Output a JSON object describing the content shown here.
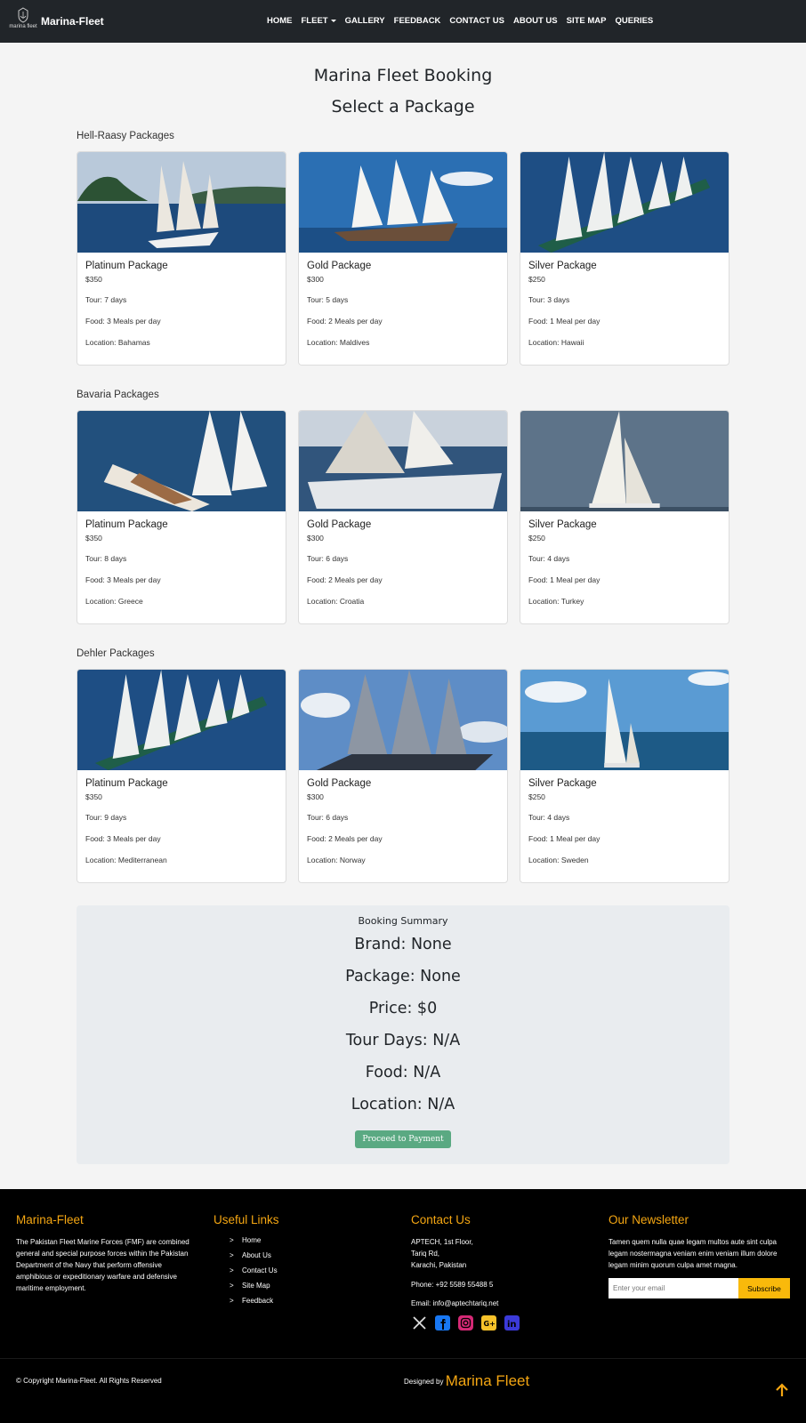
{
  "nav": {
    "logo_text": "marina fleet",
    "brand": "Marina-Fleet",
    "links": [
      "HOME",
      "FLEET",
      "GALLERY",
      "FEEDBACK",
      "CONTACT US",
      "ABOUT US",
      "SITE MAP",
      "QUERIES"
    ]
  },
  "page": {
    "title": "Marina Fleet Booking",
    "subtitle": "Select a Package"
  },
  "groups": [
    {
      "title": "Hell-Raasy Packages",
      "cards": [
        {
          "title": "Platinum Package",
          "price": "$350",
          "tour": "Tour: 7 days",
          "food": "Food: 3 Meals per day",
          "location": "Location: Bahamas"
        },
        {
          "title": "Gold Package",
          "price": "$300",
          "tour": "Tour: 5 days",
          "food": "Food: 2 Meals per day",
          "location": "Location: Maldives"
        },
        {
          "title": "Silver Package",
          "price": "$250",
          "tour": "Tour: 3 days",
          "food": "Food: 1 Meal per day",
          "location": "Location: Hawaii"
        }
      ]
    },
    {
      "title": "Bavaria Packages",
      "cards": [
        {
          "title": "Platinum Package",
          "price": "$350",
          "tour": "Tour: 8 days",
          "food": "Food: 3 Meals per day",
          "location": "Location: Greece"
        },
        {
          "title": "Gold Package",
          "price": "$300",
          "tour": "Tour: 6 days",
          "food": "Food: 2 Meals per day",
          "location": "Location: Croatia"
        },
        {
          "title": "Silver Package",
          "price": "$250",
          "tour": "Tour: 4 days",
          "food": "Food: 1 Meal per day",
          "location": "Location: Turkey"
        }
      ]
    },
    {
      "title": "Dehler Packages",
      "cards": [
        {
          "title": "Platinum Package",
          "price": "$350",
          "tour": "Tour: 9 days",
          "food": "Food: 3 Meals per day",
          "location": "Location: Mediterranean"
        },
        {
          "title": "Gold Package",
          "price": "$300",
          "tour": "Tour: 6 days",
          "food": "Food: 2 Meals per day",
          "location": "Location: Norway"
        },
        {
          "title": "Silver Package",
          "price": "$250",
          "tour": "Tour: 4 days",
          "food": "Food: 1 Meal per day",
          "location": "Location: Sweden"
        }
      ]
    }
  ],
  "summary": {
    "title": "Booking Summary",
    "brand": "Brand: None",
    "package": "Package: None",
    "price": "Price: $0",
    "tour": "Tour Days: N/A",
    "food": "Food: N/A",
    "location": "Location: N/A",
    "button": "Proceed to Payment"
  },
  "footer": {
    "about": {
      "heading": "Marina-Fleet",
      "text": "The Pakistan Fleet Marine Forces (FMF) are combined general and special purpose forces within the Pakistan Department of the Navy that perform offensive amphibious or expeditionary warfare and defensive maritime employment."
    },
    "links": {
      "heading": "Useful Links",
      "items": [
        "Home",
        "About Us",
        "Contact Us",
        "Site Map",
        "Feedback"
      ]
    },
    "contact": {
      "heading": "Contact Us",
      "address1": "APTECH, 1st Floor,",
      "address2": "Tariq Rd,",
      "address3": "Karachi, Pakistan",
      "phone": "Phone: +92 5589 55488 5",
      "email": "Email: info@aptechtariq.net"
    },
    "newsletter": {
      "heading": "Our Newsletter",
      "text": "Tamen quem nulla quae legam multos aute sint culpa legam nostermagna veniam enim veniam illum dolore legam minim quorum culpa amet magna.",
      "placeholder": "Enter your email",
      "button": "Subscribe"
    },
    "copyright": "© Copyright Marina-Fleet. All Rights Reserved",
    "designed_by": "Designed by",
    "designed_name": "Marina Fleet"
  },
  "colors": {
    "nav_bg": "#212529",
    "footer_bg": "#000000",
    "accent": "#f4a612",
    "subscribe": "#f9b90b",
    "pay_button": "#5aa982",
    "summary_bg": "#e9ecef"
  }
}
